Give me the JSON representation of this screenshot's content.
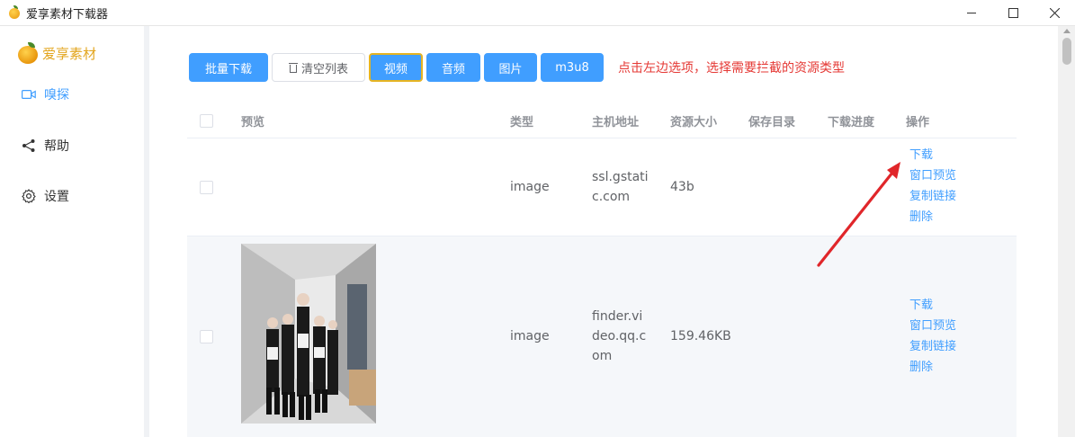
{
  "window": {
    "title": "爱享素材下载器",
    "controls": [
      "minimize",
      "maximize",
      "close"
    ]
  },
  "sidebar": {
    "logo_text": "爱享素材",
    "items": [
      {
        "label": "嗅探",
        "icon": "video-camera-icon",
        "active": true
      },
      {
        "label": "帮助",
        "icon": "share-icon",
        "active": false
      },
      {
        "label": "设置",
        "icon": "gear-icon",
        "active": false
      }
    ]
  },
  "toolbar": {
    "batch_download": "批量下载",
    "clear_list": "清空列表",
    "video": "视频",
    "audio": "音频",
    "image": "图片",
    "m3u8": "m3u8",
    "hint": "点击左边选项，选择需要拦截的资源类型"
  },
  "table": {
    "columns": [
      "预览",
      "类型",
      "主机地址",
      "资源大小",
      "保存目录",
      "下载进度",
      "操作"
    ],
    "rows": [
      {
        "type": "image",
        "host": "ssl.gstatic.com",
        "size": "43b",
        "has_preview": false
      },
      {
        "type": "image",
        "host": "finder.video.qq.com",
        "size": "159.46KB",
        "has_preview": true
      }
    ],
    "actions": [
      "下载",
      "窗口预览",
      "复制链接",
      "删除"
    ]
  },
  "colors": {
    "primary": "#409eff",
    "hint": "#e53935",
    "logo": "#e3a61f",
    "active_border": "#e6b422"
  }
}
